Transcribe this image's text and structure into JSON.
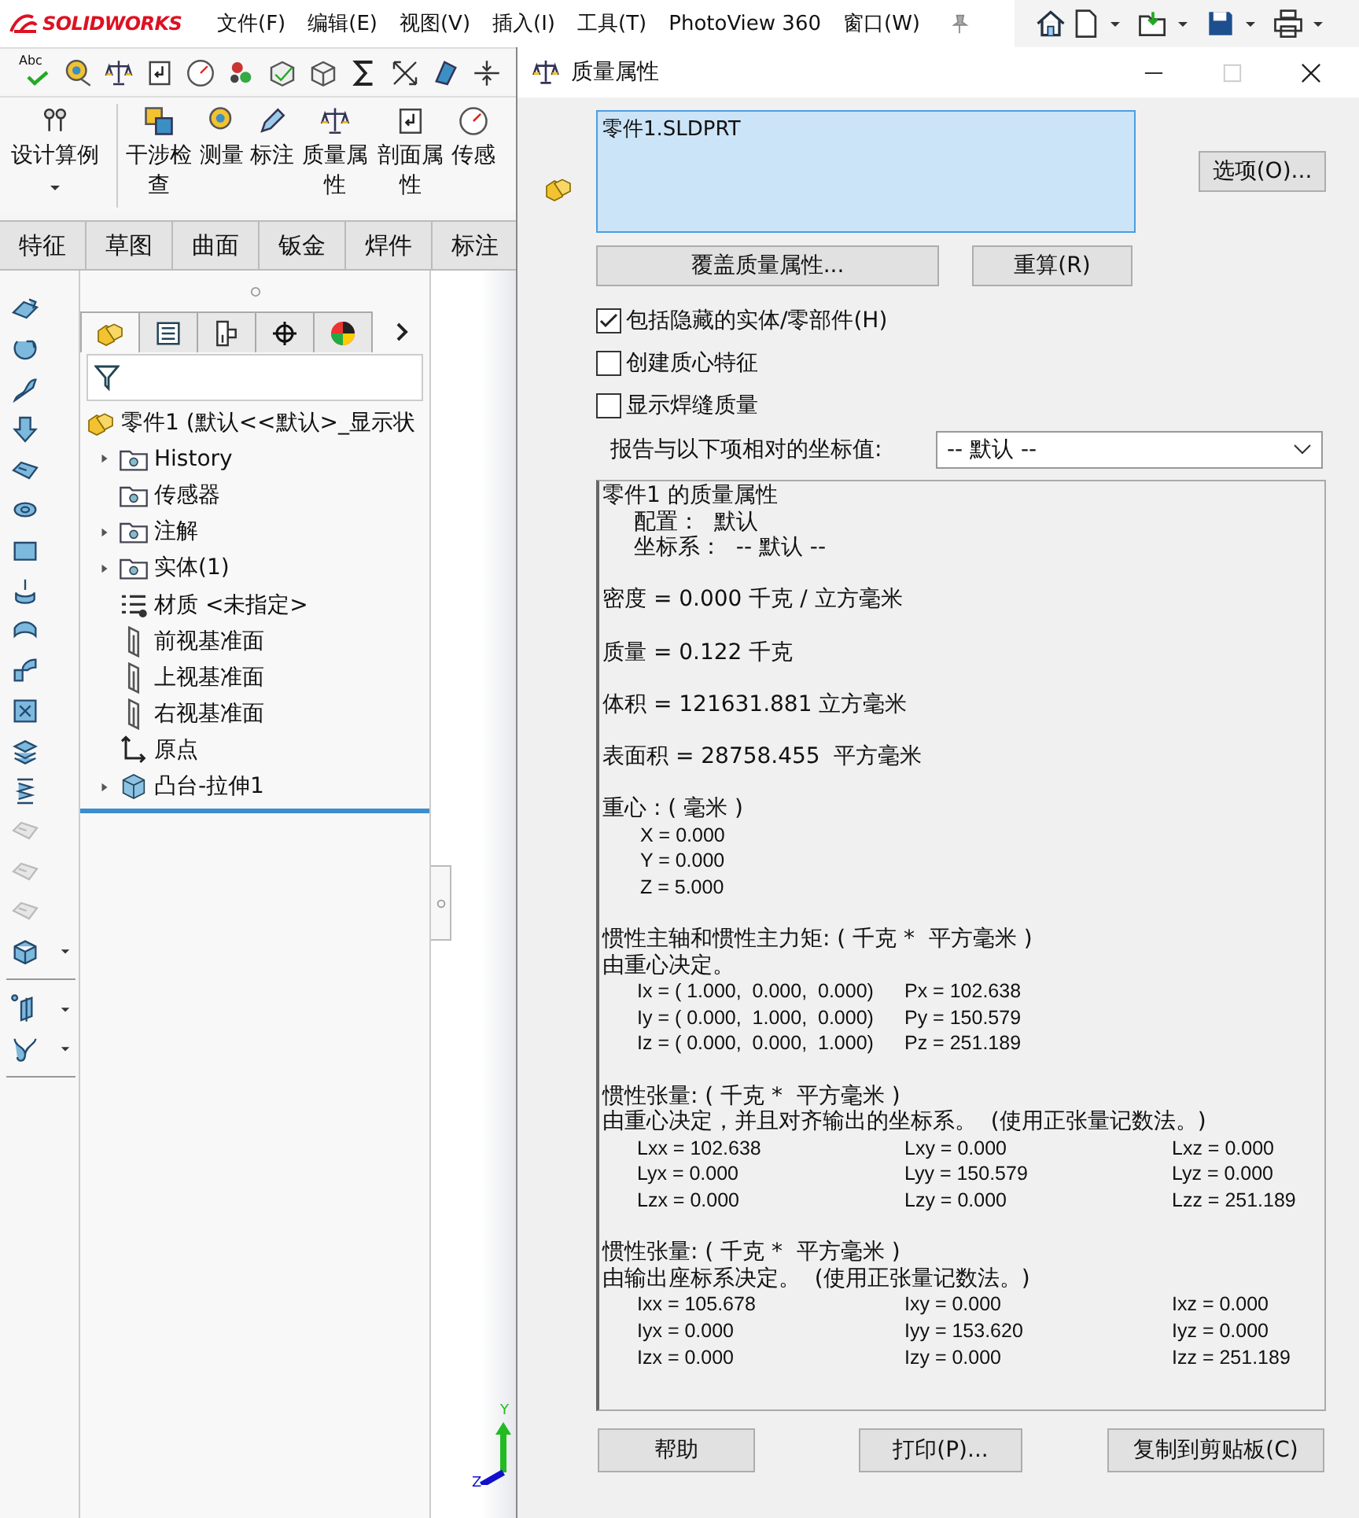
{
  "app": {
    "logo": "SOLIDWORKS",
    "menus": [
      "文件(F)",
      "编辑(E)",
      "视图(V)",
      "插入(I)",
      "工具(T)",
      "PhotoView 360",
      "窗口(W)"
    ]
  },
  "toolbar": {
    "spell_check_text": "Abc"
  },
  "ribbon": {
    "items": [
      {
        "label": "设计算例",
        "dropdown": true
      },
      {
        "label": "干涉检查",
        "dropdown": false
      },
      {
        "label": "测量",
        "dropdown": false
      },
      {
        "label": "标注",
        "dropdown": false
      },
      {
        "label": "质量属性",
        "dropdown": false
      },
      {
        "label": "剖面属性",
        "dropdown": false
      },
      {
        "label": "传感",
        "dropdown": false
      }
    ]
  },
  "command_tabs": [
    "特征",
    "草图",
    "曲面",
    "钣金",
    "焊件",
    "标注"
  ],
  "feature_toolbar": {
    "groups": [
      {
        "tools": [
          {
            "disabled": false,
            "dropdown": false
          },
          {
            "disabled": false,
            "dropdown": false
          },
          {
            "disabled": false,
            "dropdown": false
          },
          {
            "disabled": false,
            "dropdown": false
          },
          {
            "disabled": false,
            "dropdown": false
          },
          {
            "disabled": false,
            "dropdown": false
          },
          {
            "disabled": false,
            "dropdown": false
          },
          {
            "disabled": false,
            "dropdown": false
          },
          {
            "disabled": false,
            "dropdown": false
          },
          {
            "disabled": false,
            "dropdown": false
          },
          {
            "disabled": false,
            "dropdown": false
          },
          {
            "disabled": false,
            "dropdown": false
          },
          {
            "disabled": false,
            "dropdown": false
          },
          {
            "disabled": true,
            "dropdown": false
          },
          {
            "disabled": true,
            "dropdown": false
          },
          {
            "disabled": true,
            "dropdown": false
          },
          {
            "disabled": false,
            "dropdown": true
          }
        ]
      },
      {
        "tools": [
          {
            "disabled": false,
            "dropdown": true
          },
          {
            "disabled": false,
            "dropdown": true
          }
        ]
      }
    ]
  },
  "feature_manager": {
    "tabs": [
      {
        "selected": true
      },
      {
        "selected": false
      },
      {
        "selected": false
      },
      {
        "selected": false
      },
      {
        "selected": false
      }
    ]
  },
  "feature_tree": {
    "root": {
      "label": "零件1  (默认<<默认>_显示状",
      "children": [
        {
          "label": "History",
          "kind": "folder",
          "expanded": false
        },
        {
          "label": "传感器",
          "kind": "folder"
        },
        {
          "label": "注解",
          "kind": "folder",
          "expanded": false
        },
        {
          "label": "实体(1)",
          "kind": "folder",
          "expanded": false
        },
        {
          "label": "材质 <未指定>",
          "kind": "material"
        },
        {
          "label": "前视基准面",
          "kind": "plane"
        },
        {
          "label": "上视基准面",
          "kind": "plane"
        },
        {
          "label": "右视基准面",
          "kind": "plane"
        },
        {
          "label": "原点",
          "kind": "origin"
        },
        {
          "label": "凸台-拉伸1",
          "kind": "feature",
          "expanded": false
        }
      ]
    }
  },
  "triad": {
    "y_label": "Y",
    "z_label": "Z"
  },
  "dialog": {
    "title": "质量属性",
    "selected_items": [
      "零件1.SLDPRT"
    ],
    "options_button": "选项(O)...",
    "override_button": "覆盖质量属性...",
    "recalculate_button": "重算(R)",
    "checkboxes": [
      {
        "label": "包括隐藏的实体/零部件(H)",
        "checked": true
      },
      {
        "label": "创建质心特征",
        "checked": false
      },
      {
        "label": "显示焊缝质量",
        "checked": false
      }
    ],
    "coordinate_label": "报告与以下项相对的坐标值:",
    "coordinate_value": "-- 默认 --",
    "report": {
      "sections": [
        {
          "lines": [
            "零件1 的质量属性"
          ],
          "details": [
            "配置：  默认",
            "坐标系：  -- 默认 --"
          ]
        },
        {
          "lines": [
            "密度 = 0.000 千克 / 立方毫米"
          ]
        },
        {
          "lines": [
            "质量 = 0.122 千克"
          ]
        },
        {
          "lines": [
            "体积 = 121631.881 立方毫米"
          ]
        },
        {
          "lines": [
            "表面积 = 28758.455  平方毫米"
          ]
        },
        {
          "lines": [
            "重心 : ( 毫米 )"
          ],
          "values": [
            "X = 0.000",
            "Y = 0.000",
            "Z = 5.000"
          ]
        },
        {
          "lines": [
            "惯性主轴和惯性主力矩: ( 千克 *  平方毫米 )",
            "由重心决定。"
          ],
          "table": [
            [
              "Ix = ( 1.000,  0.000,  0.000)",
              "Px = 102.638"
            ],
            [
              "Iy = ( 0.000,  1.000,  0.000)",
              "Py = 150.579"
            ],
            [
              "Iz = ( 0.000,  0.000,  1.000)",
              "Pz = 251.189"
            ]
          ]
        },
        {
          "lines": [
            "惯性张量: ( 千克 *  平方毫米 )",
            "由重心决定，并且对齐输出的坐标系。  (使用正张量记数法。)"
          ],
          "table": [
            [
              "Lxx = 102.638",
              "Lxy = 0.000",
              "Lxz = 0.000"
            ],
            [
              "Lyx = 0.000",
              "Lyy = 150.579",
              "Lyz = 0.000"
            ],
            [
              "Lzx = 0.000",
              "Lzy = 0.000",
              "Lzz = 251.189"
            ]
          ]
        },
        {
          "lines": [
            "惯性张量: ( 千克 *  平方毫米 )",
            "由输出座标系决定。  (使用正张量记数法。)"
          ],
          "table": [
            [
              "Ixx = 105.678",
              "Ixy = 0.000",
              "Ixz = 0.000"
            ],
            [
              "Iyx = 0.000",
              "Iyy = 153.620",
              "Iyz = 0.000"
            ],
            [
              "Izx = 0.000",
              "Izy = 0.000",
              "Izz = 251.189"
            ]
          ]
        }
      ]
    },
    "footer_buttons": [
      "帮助",
      "打印(P)...",
      "复制到剪贴板(C)"
    ]
  }
}
